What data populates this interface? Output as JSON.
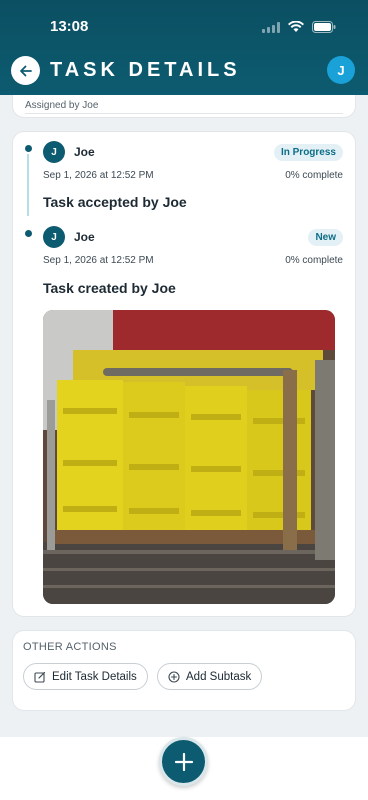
{
  "status_bar": {
    "time": "13:08"
  },
  "header": {
    "title": "TASK DETAILS",
    "avatar_initial": "J"
  },
  "assigned": {
    "text": "Assigned by Joe"
  },
  "timeline": [
    {
      "initial": "J",
      "name": "Joe",
      "badge": "In Progress",
      "date": "Sep 1, 2026 at 12:52 PM",
      "progress": "0% complete",
      "title": "Task accepted by Joe"
    },
    {
      "initial": "J",
      "name": "Joe",
      "badge": "New",
      "date": "Sep 1, 2026 at 12:52 PM",
      "progress": "0% complete",
      "title": "Task created by Joe"
    }
  ],
  "actions": {
    "label": "OTHER ACTIONS",
    "edit": "Edit Task Details",
    "add": "Add Subtask"
  },
  "colors": {
    "header": "#0d5b70",
    "accent": "#1aa1d8",
    "badge_bg": "#e3f1f6"
  },
  "icons": {
    "back": "arrow-left-icon",
    "fab": "plus-icon",
    "edit": "edit-icon",
    "add": "plus-circle-icon"
  }
}
